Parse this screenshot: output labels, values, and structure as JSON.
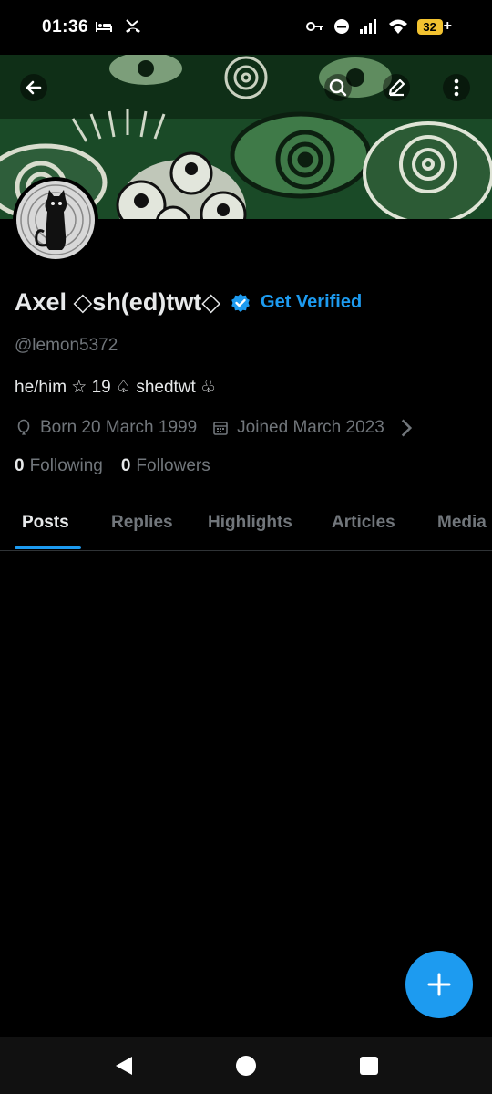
{
  "status_bar": {
    "time": "01:36",
    "left_icons": [
      "bed-icon",
      "missed-call-icon"
    ],
    "right_icons": [
      "vpn-key-icon",
      "do-not-disturb-icon",
      "signal-icon",
      "wifi-icon"
    ],
    "battery_level": "32",
    "battery_charging": "+"
  },
  "header": {
    "back_icon": "arrow-left-icon",
    "search_icon": "search-icon",
    "edit_icon": "edit-pencil-icon",
    "more_icon": "more-vertical-icon"
  },
  "profile": {
    "display_name": "Axel ◇sh(ed)twt◇",
    "get_verified_label": "Get Verified",
    "handle": "@lemon5372",
    "bio": "he/him ☆ 19 ♤ shedtwt ♧",
    "birthday": "Born 20 March 1999",
    "joined": "Joined March 2023",
    "following_count": "0",
    "following_label": "Following",
    "followers_count": "0",
    "followers_label": "Followers"
  },
  "tabs": [
    {
      "label": "Posts",
      "active": true
    },
    {
      "label": "Replies",
      "active": false
    },
    {
      "label": "Highlights",
      "active": false
    },
    {
      "label": "Articles",
      "active": false
    },
    {
      "label": "Media",
      "active": false
    }
  ],
  "fab": {
    "icon": "plus-icon"
  },
  "nav_bar": {
    "icons": [
      "back-triangle-icon",
      "home-circle-icon",
      "recents-square-icon"
    ]
  },
  "colors": {
    "accent": "#1d9bf0",
    "background": "#000000",
    "secondary_text": "#71767b",
    "primary_text": "#e7e9ea",
    "battery": "#f2c230"
  }
}
